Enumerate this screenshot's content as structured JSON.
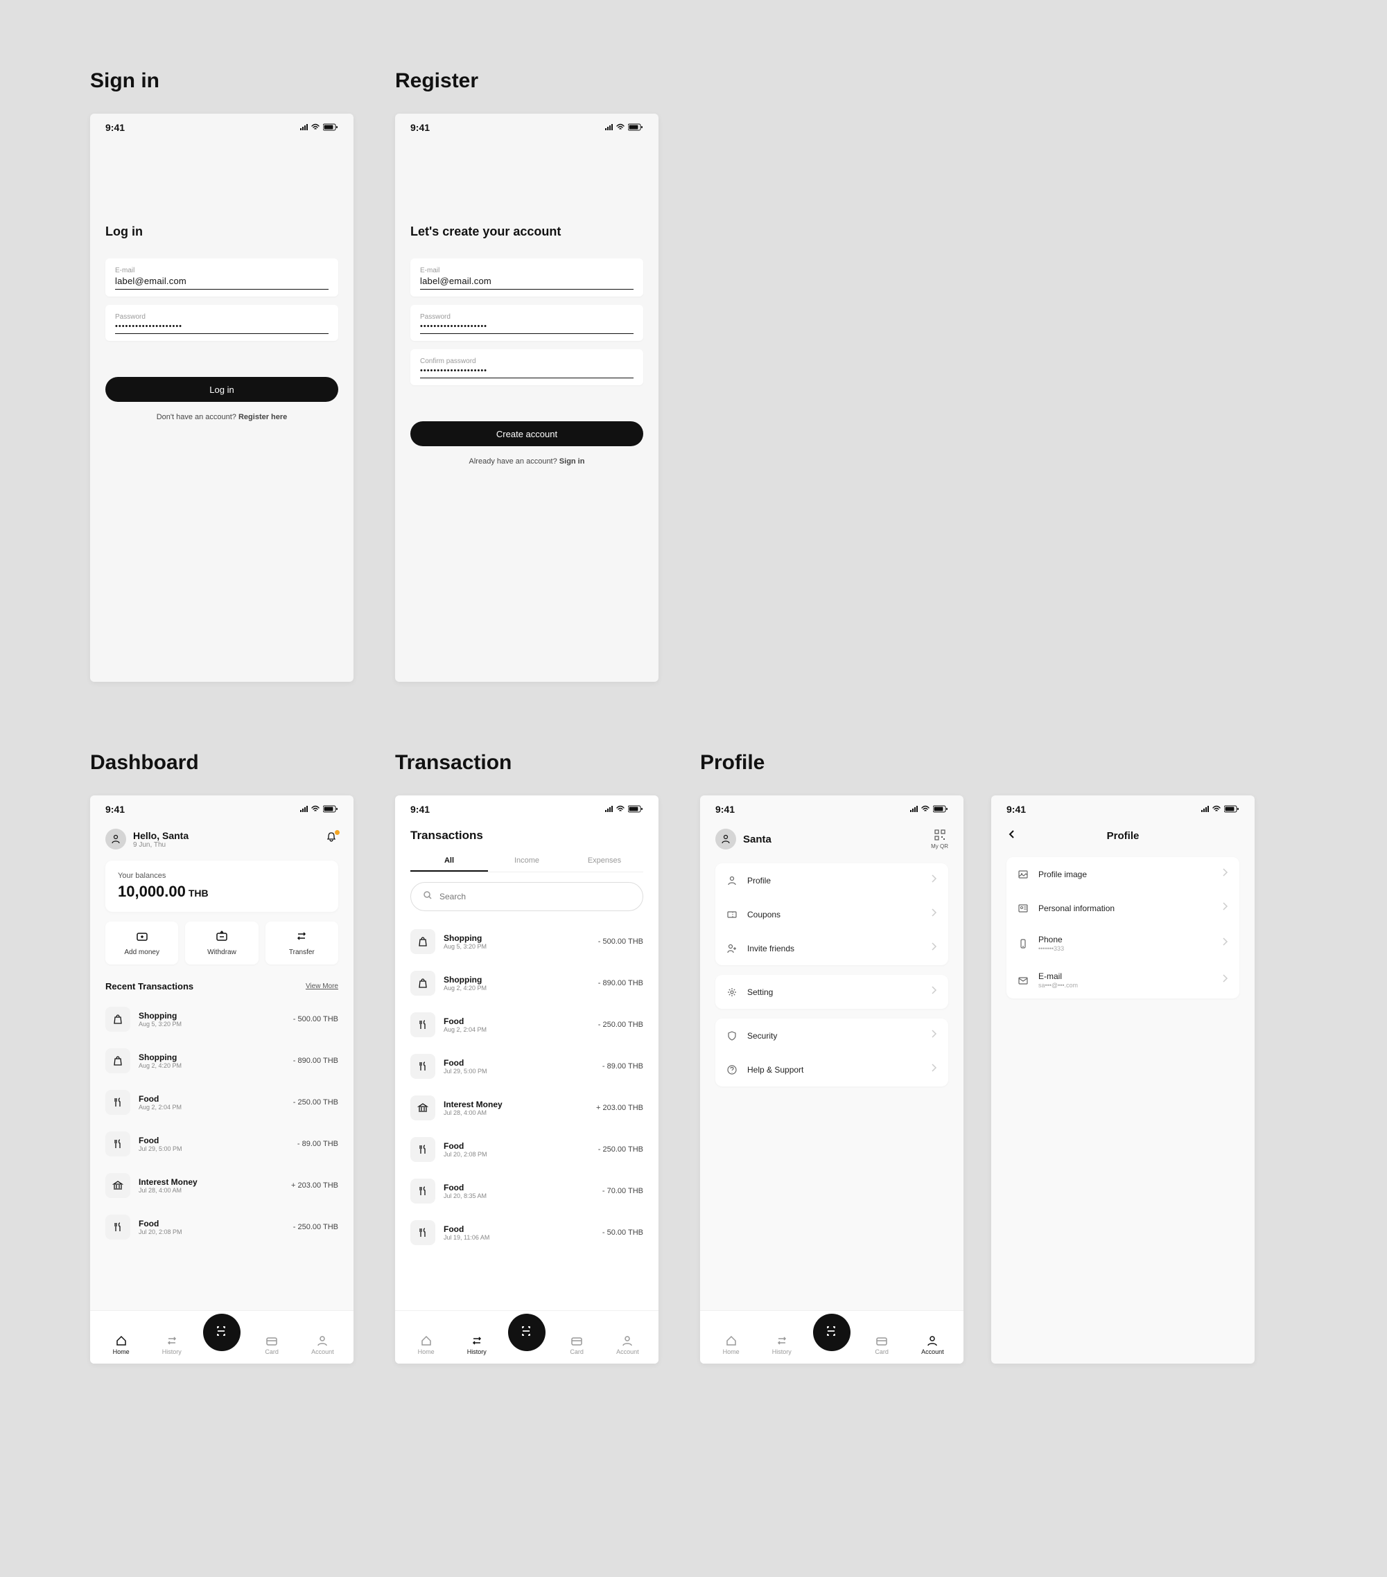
{
  "status": {
    "time": "9:41"
  },
  "signin": {
    "section_title": "Sign in",
    "title": "Log in",
    "email_label": "E-mail",
    "email_value": "label@email.com",
    "password_label": "Password",
    "password_value": "••••••••••••••••••••",
    "button": "Log in",
    "footer_text": "Don't have an account? ",
    "footer_link": "Register here"
  },
  "register": {
    "section_title": "Register",
    "title": "Let's create your account",
    "email_label": "E-mail",
    "email_value": "label@email.com",
    "password_label": "Password",
    "password_value": "••••••••••••••••••••",
    "confirm_label": "Confirm password",
    "confirm_value": "••••••••••••••••••••",
    "button": "Create account",
    "footer_text": "Already have an account? ",
    "footer_link": "Sign in"
  },
  "dashboard": {
    "section_title": "Dashboard",
    "greeting": "Hello, Santa",
    "date": "9 Jun, Thu",
    "balance_label": "Your balances",
    "balance_amount": "10,000.00",
    "balance_currency": "THB",
    "actions": {
      "add": "Add money",
      "withdraw": "Withdraw",
      "transfer": "Transfer"
    },
    "recent_title": "Recent Transactions",
    "view_more": "View More",
    "txns": [
      {
        "icon": "bag",
        "name": "Shopping",
        "date": "Aug 5, 3:20 PM",
        "amount": "- 500.00  THB"
      },
      {
        "icon": "bag",
        "name": "Shopping",
        "date": "Aug 2, 4:20 PM",
        "amount": "- 890.00  THB"
      },
      {
        "icon": "fork",
        "name": "Food",
        "date": "Aug 2, 2:04 PM",
        "amount": "- 250.00  THB"
      },
      {
        "icon": "fork",
        "name": "Food",
        "date": "Jul 29, 5:00 PM",
        "amount": "- 89.00  THB"
      },
      {
        "icon": "bank",
        "name": "Interest Money",
        "date": "Jul 28, 4:00 AM",
        "amount": "+ 203.00  THB"
      },
      {
        "icon": "fork",
        "name": "Food",
        "date": "Jul 20, 2:08 PM",
        "amount": "- 250.00  THB"
      }
    ]
  },
  "transactions": {
    "section_title": "Transaction",
    "title": "Transactions",
    "tabs": {
      "all": "All",
      "income": "Income",
      "expenses": "Expenses"
    },
    "search_placeholder": "Search",
    "txns": [
      {
        "icon": "bag",
        "name": "Shopping",
        "date": "Aug 5, 3:20 PM",
        "amount": "- 500.00  THB"
      },
      {
        "icon": "bag",
        "name": "Shopping",
        "date": "Aug 2, 4:20 PM",
        "amount": "- 890.00  THB"
      },
      {
        "icon": "fork",
        "name": "Food",
        "date": "Aug 2, 2:04 PM",
        "amount": "- 250.00  THB"
      },
      {
        "icon": "fork",
        "name": "Food",
        "date": "Jul 29, 5:00 PM",
        "amount": "- 89.00  THB"
      },
      {
        "icon": "bank",
        "name": "Interest Money",
        "date": "Jul 28, 4:00 AM",
        "amount": "+ 203.00  THB"
      },
      {
        "icon": "fork",
        "name": "Food",
        "date": "Jul 20, 2:08 PM",
        "amount": "- 250.00  THB"
      },
      {
        "icon": "fork",
        "name": "Food",
        "date": "Jul 20, 8:35 AM",
        "amount": "- 70.00  THB"
      },
      {
        "icon": "fork",
        "name": "Food",
        "date": "Jul 19, 11:06 AM",
        "amount": "- 50.00  THB"
      }
    ]
  },
  "profile_menu": {
    "section_title": "Profile",
    "name": "Santa",
    "qr_label": "My QR",
    "groups": [
      {
        "items": [
          {
            "icon": "person",
            "label": "Profile"
          },
          {
            "icon": "ticket",
            "label": "Coupons"
          },
          {
            "icon": "add-friend",
            "label": "Invite friends"
          }
        ]
      },
      {
        "items": [
          {
            "icon": "gear",
            "label": "Setting"
          }
        ]
      },
      {
        "items": [
          {
            "icon": "shield",
            "label": "Security"
          },
          {
            "icon": "help",
            "label": "Help & Support"
          }
        ]
      }
    ]
  },
  "profile_edit": {
    "title": "Profile",
    "items": [
      {
        "icon": "image",
        "label": "Profile image",
        "sub": ""
      },
      {
        "icon": "id",
        "label": "Personal information",
        "sub": ""
      },
      {
        "icon": "phone",
        "label": "Phone",
        "sub": "•••••••333"
      },
      {
        "icon": "mail",
        "label": "E-mail",
        "sub": "sa•••@•••.com"
      }
    ]
  },
  "tabbar": {
    "home": "Home",
    "history": "History",
    "card": "Card",
    "account": "Account"
  }
}
